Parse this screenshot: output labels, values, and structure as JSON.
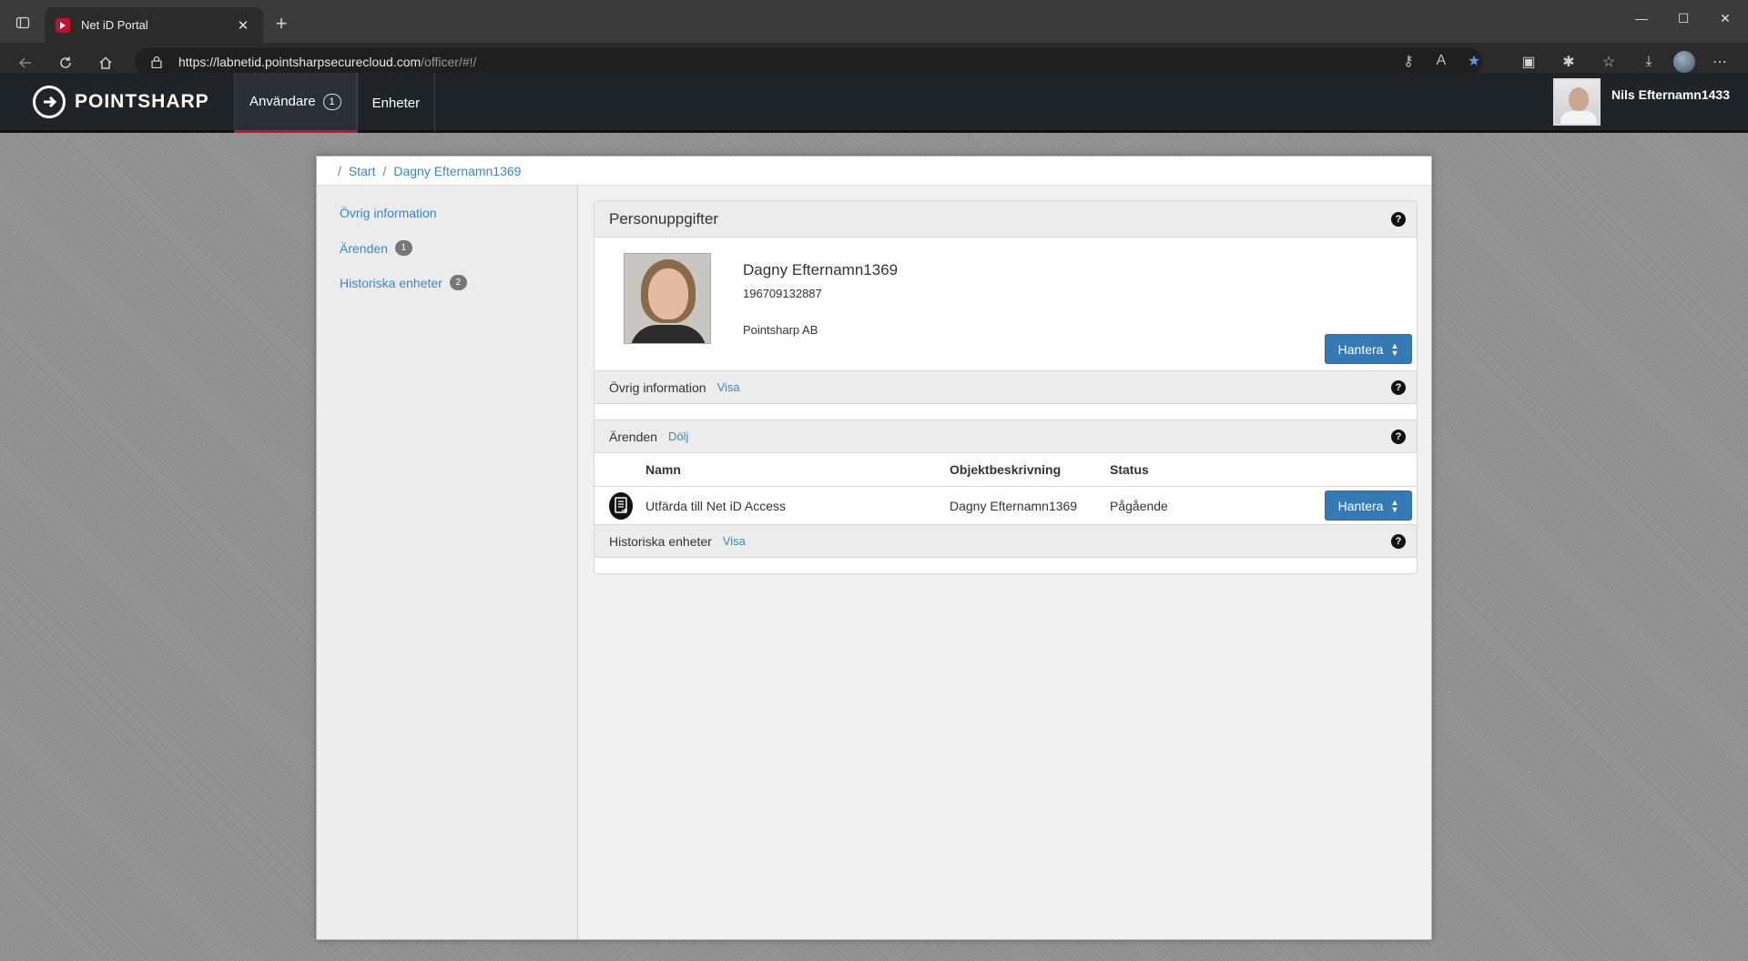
{
  "browser": {
    "tab_title": "Net iD Portal",
    "url_host": "https://labnetid.pointsharpsecurecloud.com",
    "url_path": "/officer/#!/"
  },
  "app": {
    "logo_text": "POINTSHARP",
    "nav": [
      {
        "label": "Användare",
        "badge": "1"
      },
      {
        "label": "Enheter"
      }
    ],
    "user_name": "Nils Efternamn1433"
  },
  "breadcrumb": {
    "sep": "/",
    "start": "Start",
    "current": "Dagny Efternamn1369"
  },
  "sidebar": {
    "items": [
      {
        "label": "Övrig information"
      },
      {
        "label": "Ärenden",
        "badge": "1"
      },
      {
        "label": "Historiska enheter",
        "badge": "2"
      }
    ]
  },
  "panel": {
    "title": "Personuppgifter",
    "help": "?",
    "person": {
      "name": "Dagny Efternamn1369",
      "id": "196709132887",
      "org": "Pointsharp AB"
    },
    "manage_label": "Hantera",
    "other_info": {
      "label": "Övrig information",
      "link": "Visa"
    },
    "cases": {
      "label": "Ärenden",
      "link": "Dölj",
      "columns": [
        "Namn",
        "Objektbeskrivning",
        "Status"
      ],
      "rows": [
        {
          "name": "Utfärda till Net iD Access",
          "object": "Dagny Efternamn1369",
          "status": "Pågående"
        }
      ]
    },
    "history": {
      "label": "Historiska enheter",
      "link": "Visa"
    }
  }
}
